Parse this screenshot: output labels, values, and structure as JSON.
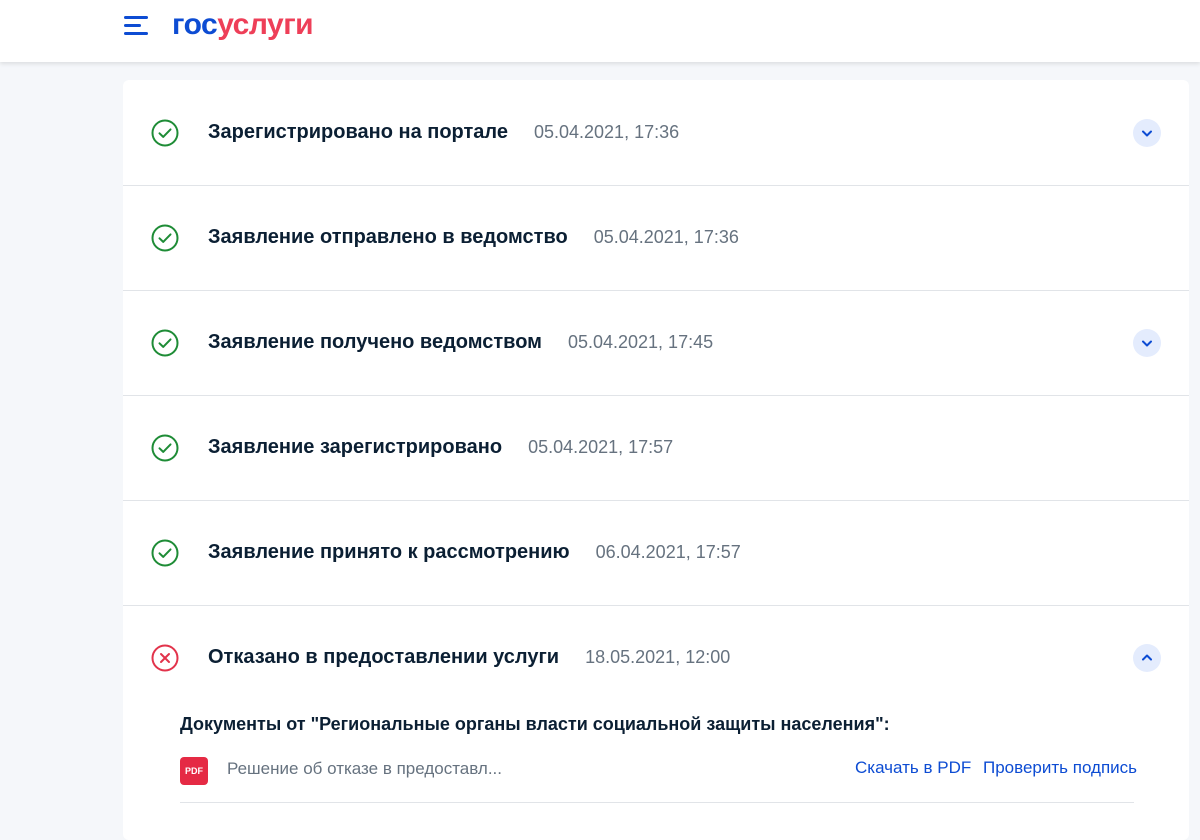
{
  "header": {
    "logo_part1": "гос",
    "logo_part2": "услуги",
    "brand_blue": "#0d4cd3",
    "brand_red": "#ee3f58"
  },
  "timeline": [
    {
      "title": "Зарегистрировано на портале",
      "date": "05.04.2021, 17:36",
      "status": "success",
      "expander": "chevron-down"
    },
    {
      "title": "Заявление отправлено в ведомство",
      "date": "05.04.2021, 17:36",
      "status": "success",
      "expander": null
    },
    {
      "title": "Заявление получено ведомством",
      "date": "05.04.2021, 17:45",
      "status": "success",
      "expander": "chevron-down"
    },
    {
      "title": "Заявление зарегистрировано",
      "date": "05.04.2021, 17:57",
      "status": "success",
      "expander": null
    },
    {
      "title": "Заявление принято к рассмотрению",
      "date": "06.04.2021, 17:57",
      "status": "success",
      "expander": null
    },
    {
      "title": "Отказано в предоставлении услуги",
      "date": "18.05.2021, 12:00",
      "status": "rejected",
      "expander": "chevron-up"
    }
  ],
  "documents": {
    "heading": "Документы от \"Региональные органы власти социальной защиты населения\":",
    "items": [
      {
        "badge": "PDF",
        "name": "Решение об отказе в предоставл...",
        "download_label": "Скачать в PDF",
        "verify_label": "Проверить подпись"
      }
    ]
  },
  "colors": {
    "success": "#1e8c36",
    "error": "#e2334b",
    "link": "#0d4cd3",
    "muted": "#66727f"
  }
}
